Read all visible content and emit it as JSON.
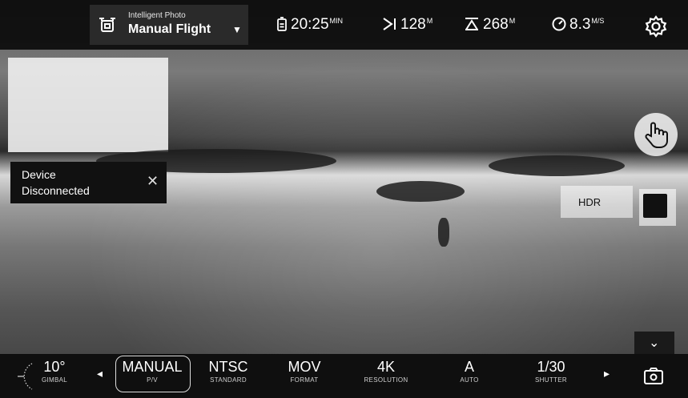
{
  "top_bar": {
    "mode_subtitle": "Intelligent Photo",
    "mode_title": "Manual Flight",
    "telemetry": [
      {
        "name": "battery",
        "value": "20:25",
        "unit": "MIN"
      },
      {
        "name": "distance",
        "value": "128",
        "unit": "M"
      },
      {
        "name": "altitude",
        "value": "268",
        "unit": "M"
      },
      {
        "name": "speed",
        "value": "8.3",
        "unit": "M/S"
      }
    ]
  },
  "toast": {
    "line1": "Device",
    "line2": "Disconnected",
    "close": "✕"
  },
  "right_panel": {
    "hdr_label": "HDR",
    "expand_glyph": "⌄"
  },
  "bottom_bar": {
    "gimbal": {
      "value": "10°",
      "label": "GIMBAL"
    },
    "settings": [
      {
        "value": "MANUAL",
        "label": "P/V"
      },
      {
        "value": "NTSC",
        "label": "STANDARD"
      },
      {
        "value": "MOV",
        "label": "FORMAT"
      },
      {
        "value": "4K",
        "label": "RESOLUTION"
      },
      {
        "value": "A",
        "label": "AUTO"
      },
      {
        "value": "1/30",
        "label": "SHUTTER"
      }
    ],
    "prev_glyph": "◂",
    "next_glyph": "▸"
  },
  "icons": {
    "mode": "drone-icon",
    "battery": "battery-icon",
    "distance": "distance-icon",
    "altitude": "altitude-icon",
    "speed": "speed-icon",
    "settings": "gear-icon",
    "hand": "hand-pointer-icon",
    "camera": "camera-switch-icon"
  }
}
